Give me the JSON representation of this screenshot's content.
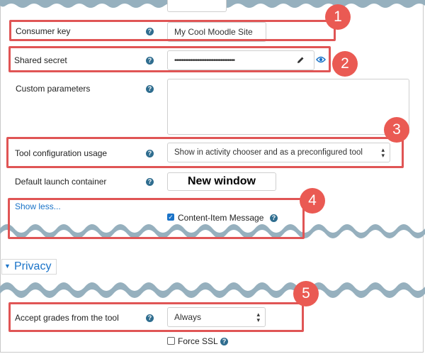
{
  "fields": {
    "consumer_key": {
      "label": "Consumer key",
      "value": "My Cool Moodle Site"
    },
    "shared_secret": {
      "label": "Shared secret",
      "value": "••••••••••••••••••••••••••••••••••",
      "edit_icon": "pencil-icon",
      "reveal_icon": "eye-icon"
    },
    "custom_parameters": {
      "label": "Custom parameters",
      "value": ""
    },
    "tool_configuration_usage": {
      "label": "Tool configuration usage",
      "value": "Show in activity chooser and as a preconfigured tool"
    },
    "default_launch_container": {
      "label": "Default launch container",
      "value": "New window"
    },
    "show_less": {
      "label": "Show less..."
    },
    "content_item_message": {
      "label": "Content-Item Message",
      "checked": true
    },
    "privacy_section": {
      "label": "Privacy"
    },
    "accept_grades": {
      "label": "Accept grades from the tool",
      "value": "Always"
    },
    "force_ssl": {
      "label": "Force SSL",
      "checked": false
    }
  },
  "help_icon": {
    "glyph": "?"
  },
  "badges": [
    "1",
    "2",
    "3",
    "4",
    "5"
  ],
  "colors": {
    "highlight": "#e05555",
    "badge": "#ea5a53",
    "link": "#1a73c8",
    "help": "#2f6d8f",
    "wave": "#96b0be"
  }
}
